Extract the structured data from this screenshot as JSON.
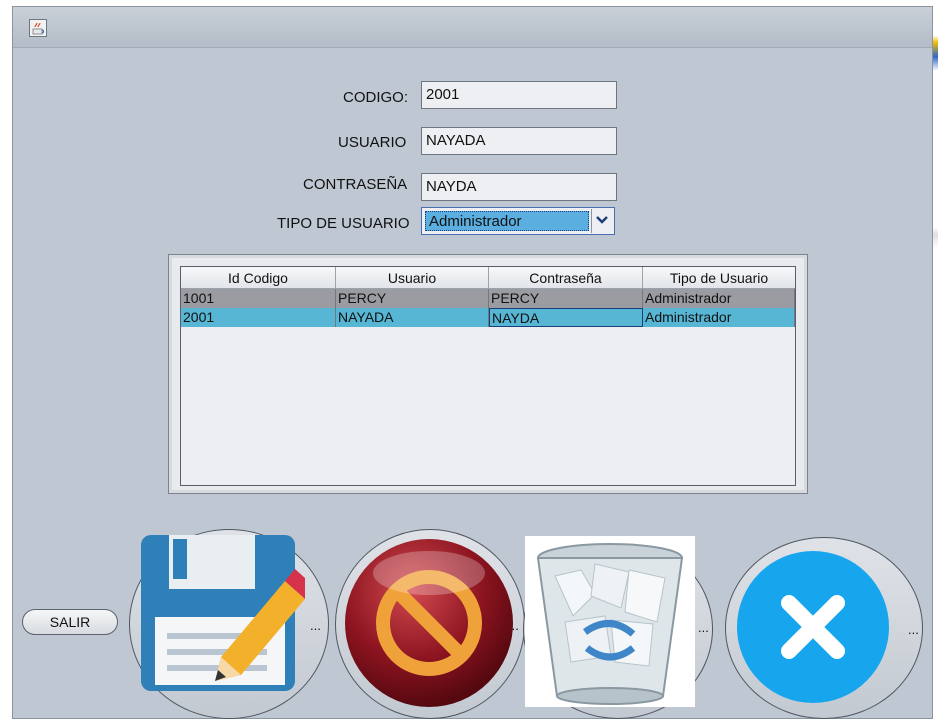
{
  "window": {
    "title": ""
  },
  "form": {
    "codigo": {
      "label": "CODIGO:",
      "value": "2001"
    },
    "usuario": {
      "label": "USUARIO",
      "value": "NAYADA"
    },
    "contrasena": {
      "label": "CONTRASEÑA",
      "value": "NAYDA"
    },
    "tipo": {
      "label": "TIPO DE USUARIO",
      "value": "Administrador"
    }
  },
  "table": {
    "headers": [
      "Id Codigo",
      "Usuario",
      "Contraseña",
      "Tipo de Usuario"
    ],
    "rows": [
      [
        "1001",
        "PERCY",
        "PERCY",
        "Administrador"
      ],
      [
        "2001",
        "NAYADA",
        "NAYDA",
        "Administrador"
      ]
    ],
    "selected_row": 1
  },
  "buttons": {
    "salir": "SALIR",
    "guardar_more": "...",
    "cancelar_more": "...",
    "eliminar_more": "...",
    "cerrar_more": "..."
  },
  "icons": {
    "save": "floppy-disk-pencil-icon",
    "cancel": "prohibited-icon",
    "delete": "recycle-bin-icon",
    "close": "close-x-icon"
  },
  "colors": {
    "window_bg": "#bec7d2",
    "selected_row": "#56b6d4",
    "row_gray": "#9a9ca1",
    "close_blue": "#17a6ee",
    "cancel_red": "#8c1420"
  }
}
